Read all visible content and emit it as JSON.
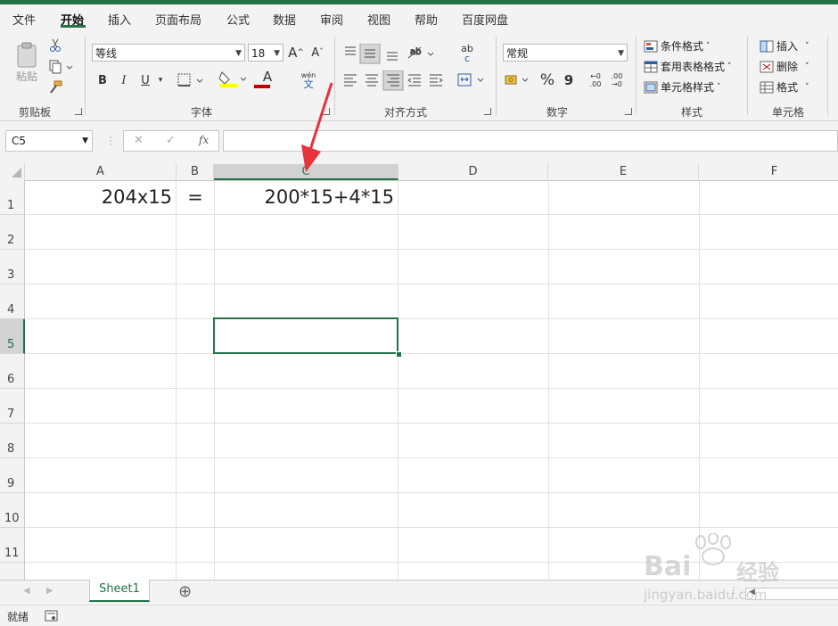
{
  "menu": [
    "文件",
    "开始",
    "插入",
    "页面布局",
    "公式",
    "数据",
    "审阅",
    "视图",
    "帮助",
    "百度网盘"
  ],
  "ribbon": {
    "clipboard": {
      "label": "剪贴板",
      "paste": "粘贴"
    },
    "font": {
      "label": "字体",
      "font_name": "等线",
      "font_size": "18",
      "grow": "A",
      "shrink": "A",
      "bold": "B",
      "italic": "I",
      "underline": "U",
      "color": "A",
      "phonetic_top": "wén",
      "phonetic_bottom": "文"
    },
    "align": {
      "label": "对齐方式",
      "wrap_top": "ab",
      "wrap_bottom": "c"
    },
    "number": {
      "label": "数字",
      "format": "常规",
      "percent": "%",
      "comma": "9",
      "inc_decimal": "←0\n.00",
      "dec_decimal": ".00\n→0"
    },
    "styles": {
      "label": "样式",
      "conditional": "条件格式",
      "table": "套用表格格式",
      "cell": "单元格样式"
    },
    "cells": {
      "label": "单元格",
      "insert": "插入",
      "delete": "删除",
      "format": "格式"
    }
  },
  "formula_bar": {
    "name_box": "C5",
    "cancel": "✕",
    "enter": "✓",
    "fx": "fx",
    "value": ""
  },
  "columns": [
    "A",
    "B",
    "C",
    "D",
    "E",
    "F"
  ],
  "rows": [
    "1",
    "2",
    "3",
    "4",
    "5",
    "6",
    "7",
    "8",
    "9",
    "10",
    "11"
  ],
  "cells": {
    "A1": "204x15",
    "B1": "=",
    "C1": "200*15+4*15"
  },
  "selected_cell": "C5",
  "sheet_tab": "Sheet1",
  "add_sheet": "⊕",
  "status": {
    "mode": "就绪"
  },
  "watermark": {
    "brand": "Bai",
    "brand2": "经验",
    "url": "jingyan.baidu.com"
  },
  "colors": {
    "excel_green": "#217346",
    "arrow_red": "#e8323c",
    "font_color_bar": "#c00000",
    "highlight_bar": "#ffff00"
  }
}
